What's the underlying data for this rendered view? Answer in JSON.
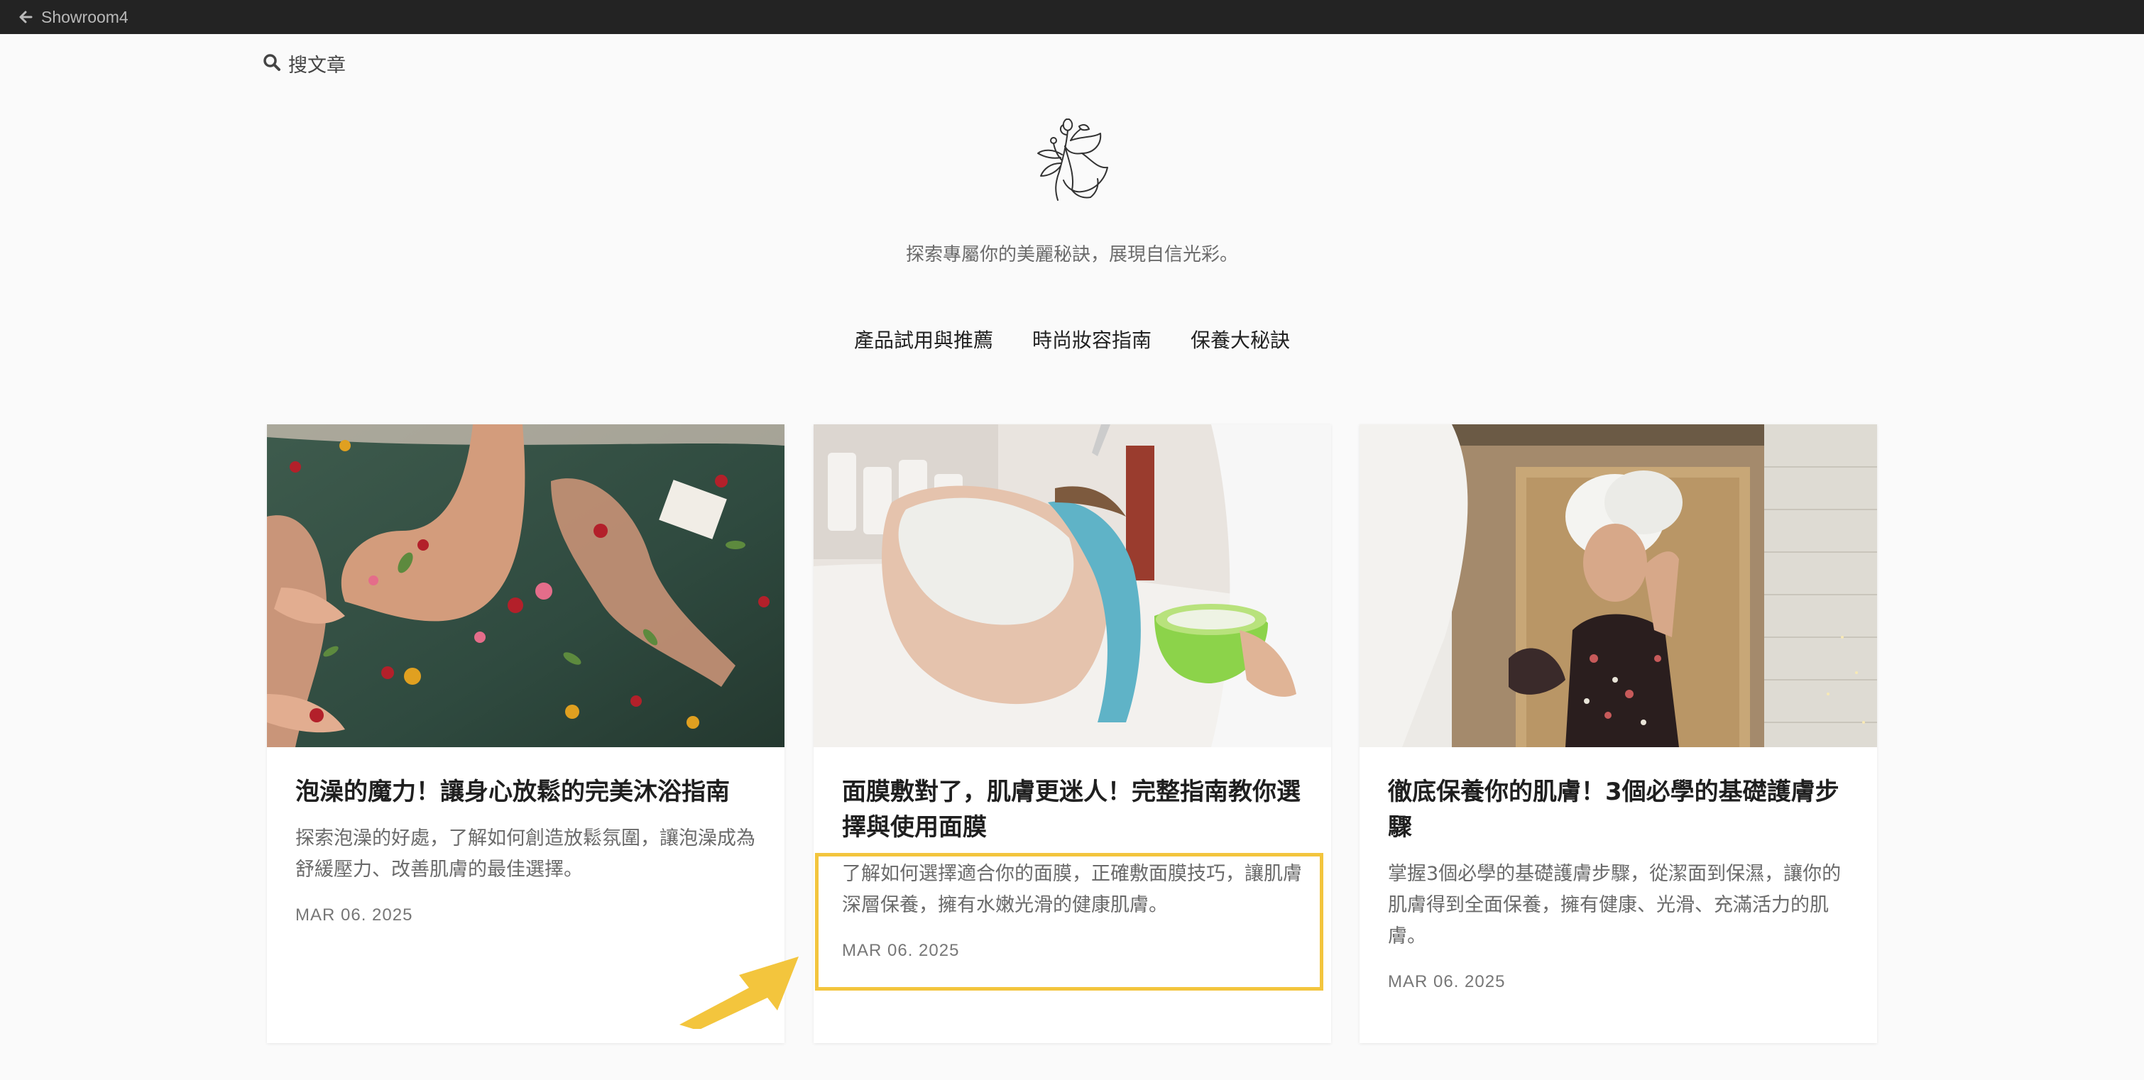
{
  "window": {
    "back_label": "Showroom4"
  },
  "search": {
    "label": "搜文章"
  },
  "header": {
    "tagline": "探索專屬你的美麗秘訣，展現自信光彩。"
  },
  "nav": {
    "items": [
      "產品試用與推薦",
      "時尚妝容指南",
      "保養大秘訣"
    ]
  },
  "articles": [
    {
      "title": "泡澡的魔力！讓身心放鬆的完美沐浴指南",
      "description": "探索泡澡的好處，了解如何創造放鬆氛圍，讓泡澡成為舒緩壓力、改善肌膚的最佳選擇。",
      "date": "MAR 06. 2025"
    },
    {
      "title": "面膜敷對了，肌膚更迷人！完整指南教你選擇與使用面膜",
      "description": "了解如何選擇適合你的面膜，正確敷面膜技巧，讓肌膚深層保養，擁有水嫩光滑的健康肌膚。",
      "date": "MAR 06. 2025"
    },
    {
      "title": "徹底保養你的肌膚！3個必學的基礎護膚步驟",
      "description": "掌握3個必學的基礎護膚步驟，從潔面到保濕，讓你的肌膚得到全面保養，擁有健康、光滑、充滿活力的肌膚。",
      "date": "MAR 06. 2025"
    }
  ],
  "colors": {
    "topbar": "#232323",
    "background": "#fafafa",
    "highlight": "#f3c53d"
  }
}
